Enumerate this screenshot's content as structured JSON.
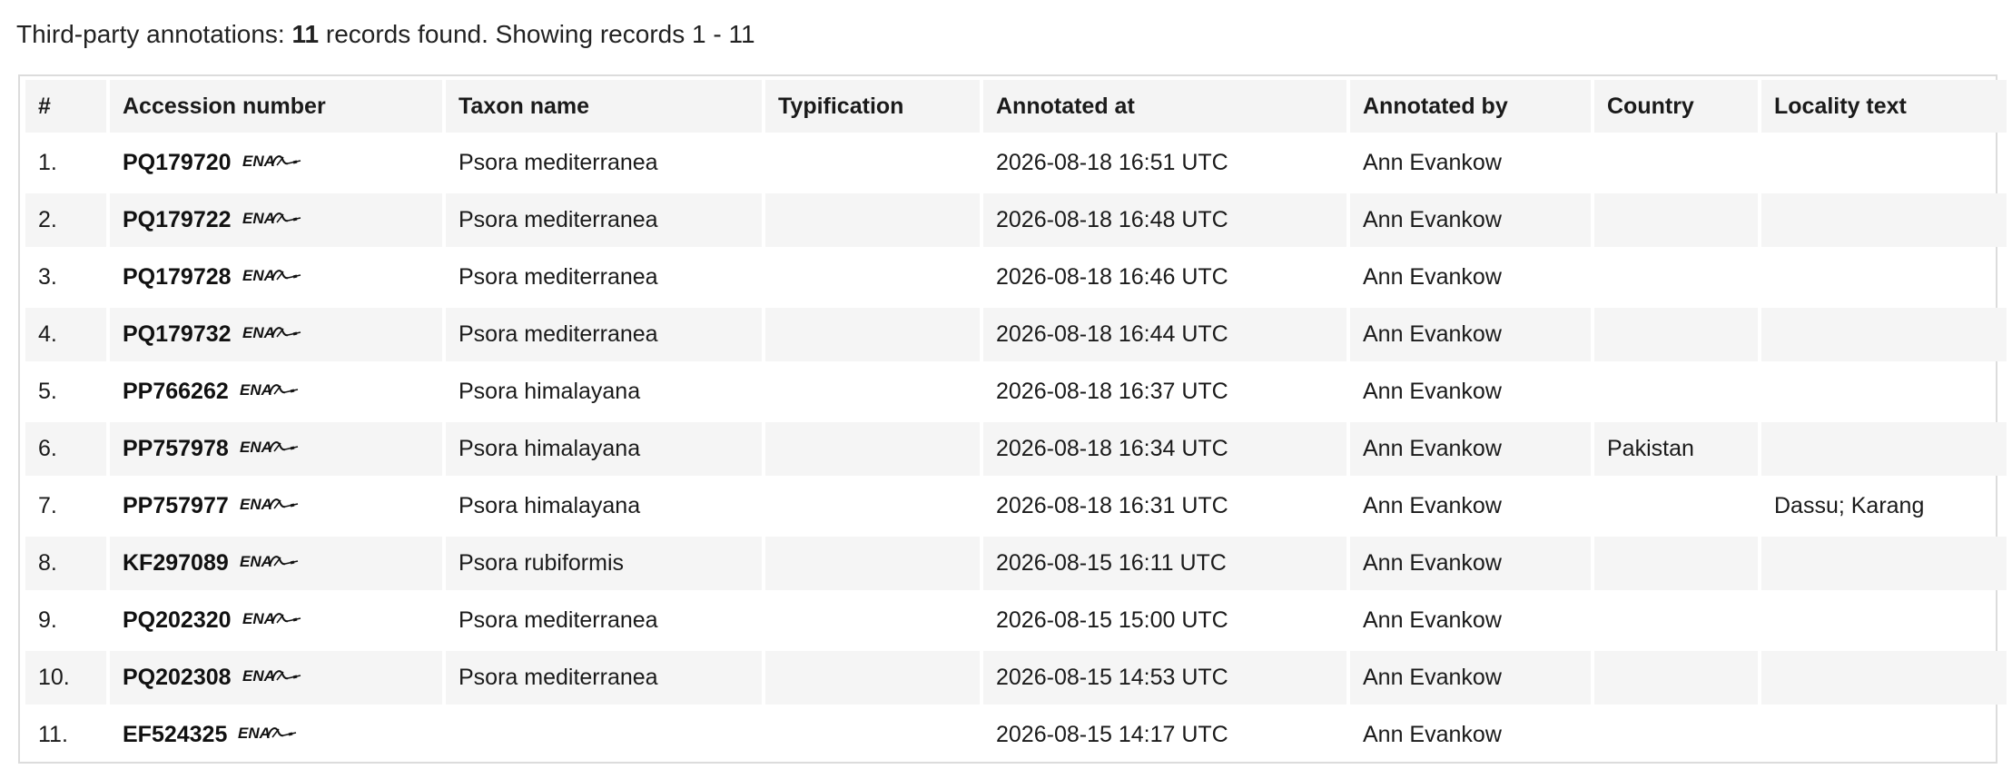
{
  "summary": {
    "prefix": "Third-party annotations: ",
    "count": "11",
    "suffix": " records found. Showing records 1 - 11"
  },
  "columns": {
    "num": "#",
    "accession": "Accession number",
    "taxon": "Taxon name",
    "typification": "Typification",
    "annotated_at": "Annotated at",
    "annotated_by": "Annotated by",
    "country": "Country",
    "locality": "Locality text"
  },
  "icons": {
    "ena": "ena-logo-icon"
  },
  "rows": [
    {
      "num": "1.",
      "accession": "PQ179720",
      "taxon": "Psora mediterranea",
      "typification": "",
      "annotated_at": "2026-08-18 16:51 UTC",
      "annotated_by": "Ann Evankow",
      "country": "",
      "locality": ""
    },
    {
      "num": "2.",
      "accession": "PQ179722",
      "taxon": "Psora mediterranea",
      "typification": "",
      "annotated_at": "2026-08-18 16:48 UTC",
      "annotated_by": "Ann Evankow",
      "country": "",
      "locality": ""
    },
    {
      "num": "3.",
      "accession": "PQ179728",
      "taxon": "Psora mediterranea",
      "typification": "",
      "annotated_at": "2026-08-18 16:46 UTC",
      "annotated_by": "Ann Evankow",
      "country": "",
      "locality": ""
    },
    {
      "num": "4.",
      "accession": "PQ179732",
      "taxon": "Psora mediterranea",
      "typification": "",
      "annotated_at": "2026-08-18 16:44 UTC",
      "annotated_by": "Ann Evankow",
      "country": "",
      "locality": ""
    },
    {
      "num": "5.",
      "accession": "PP766262",
      "taxon": "Psora himalayana",
      "typification": "",
      "annotated_at": "2026-08-18 16:37 UTC",
      "annotated_by": "Ann Evankow",
      "country": "",
      "locality": ""
    },
    {
      "num": "6.",
      "accession": "PP757978",
      "taxon": "Psora himalayana",
      "typification": "",
      "annotated_at": "2026-08-18 16:34 UTC",
      "annotated_by": "Ann Evankow",
      "country": "Pakistan",
      "locality": ""
    },
    {
      "num": "7.",
      "accession": "PP757977",
      "taxon": "Psora himalayana",
      "typification": "",
      "annotated_at": "2026-08-18 16:31 UTC",
      "annotated_by": "Ann Evankow",
      "country": "",
      "locality": "Dassu; Karang"
    },
    {
      "num": "8.",
      "accession": "KF297089",
      "taxon": "Psora rubiformis",
      "typification": "",
      "annotated_at": "2026-08-15 16:11 UTC",
      "annotated_by": "Ann Evankow",
      "country": "",
      "locality": ""
    },
    {
      "num": "9.",
      "accession": "PQ202320",
      "taxon": "Psora mediterranea",
      "typification": "",
      "annotated_at": "2026-08-15 15:00 UTC",
      "annotated_by": "Ann Evankow",
      "country": "",
      "locality": ""
    },
    {
      "num": "10.",
      "accession": "PQ202308",
      "taxon": "Psora mediterranea",
      "typification": "",
      "annotated_at": "2026-08-15 14:53 UTC",
      "annotated_by": "Ann Evankow",
      "country": "",
      "locality": ""
    },
    {
      "num": "11.",
      "accession": "EF524325",
      "taxon": "",
      "typification": "",
      "annotated_at": "2026-08-15 14:17 UTC",
      "annotated_by": "Ann Evankow",
      "country": "",
      "locality": ""
    }
  ]
}
